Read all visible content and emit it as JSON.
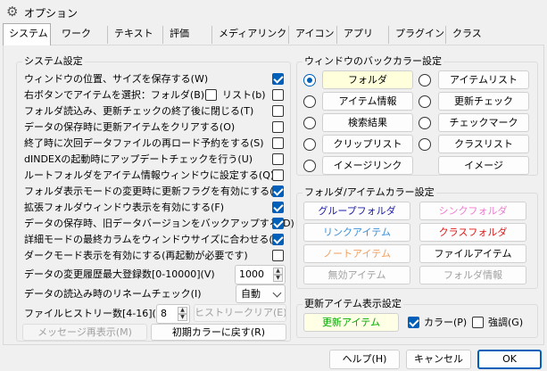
{
  "window": {
    "title": "オプション",
    "icon": "gear-icon"
  },
  "tabs": [
    "システム",
    "ワーク",
    "テキスト",
    "評価",
    "メディアリンク",
    "アイコン",
    "アプリ",
    "プラグイン",
    "クラス"
  ],
  "system": {
    "title": "システム設定",
    "options": [
      {
        "label": "ウィンドウの位置、サイズを保存する(W)",
        "checked": true
      },
      {
        "label": "右ボタンでアイテムを選択：フォルダ(B)",
        "checked": false,
        "extra_label": "リスト(b)",
        "extra_checked": false
      },
      {
        "label": "フォルダ読込み、更新チェックの終了後に閉じる(T)",
        "checked": false
      },
      {
        "label": "データの保存時に更新アイテムをクリアする(O)",
        "checked": false
      },
      {
        "label": "終了時に次回データファイルの再ロード予約をする(S)",
        "checked": false
      },
      {
        "label": "dINDEXの起動時にアップデートチェックを行う(U)",
        "checked": false
      },
      {
        "label": "ルートフォルダをアイテム情報ウィンドウに設定する(Q)",
        "checked": false
      },
      {
        "label": "フォルダ表示モードの変更時に更新フラグを有効にする(Y)",
        "checked": true
      },
      {
        "label": "拡張フォルダウィンドウ表示を有効にする(F)",
        "checked": true
      },
      {
        "label": "データの保存時、旧データバージョンをバックアップする(D)",
        "checked": true
      },
      {
        "label": "詳細モードの最終カラムをウィンドウサイズに合わせる(A)",
        "checked": true
      },
      {
        "label": "ダークモード表示を有効にする(再起動が必要です)",
        "checked": false
      }
    ],
    "history_max_label": "データの変更履歴最大登録数[0-10000](V)",
    "history_max_value": "1000",
    "rename_check_label": "データの読込み時のリネームチェック(I)",
    "rename_check_value": "自動",
    "file_history_label": "ファイルヒストリー数[4-16](N)",
    "file_history_value": "8",
    "clear_history_label": "ヒストリークリア(E)",
    "redisplay_label": "メッセージ再表示(M)",
    "reset_colors_label": "初期カラーに戻す(R)"
  },
  "bgcolor": {
    "title": "ウィンドウのバックカラー設定",
    "left": [
      {
        "label": "フォルダ",
        "selected": true,
        "bg": "#ffffdc"
      },
      {
        "label": "アイテム情報",
        "selected": false,
        "bg": "#fdfdfd"
      },
      {
        "label": "検索結果",
        "selected": false,
        "bg": "#fdfdfd"
      },
      {
        "label": "クリップリスト",
        "selected": false,
        "bg": "#fdfdfd"
      },
      {
        "label": "イメージリンク",
        "selected": false,
        "bg": "#fdfdfd"
      }
    ],
    "right": [
      {
        "label": "アイテムリスト",
        "selected": false,
        "bg": "#fdfdfd"
      },
      {
        "label": "更新チェック",
        "selected": false,
        "bg": "#fdfdfd"
      },
      {
        "label": "チェックマーク",
        "selected": false,
        "bg": "#fdfdfd"
      },
      {
        "label": "クラスリスト",
        "selected": false,
        "bg": "#fdfdfd"
      },
      {
        "label": "イメージ",
        "selected": null,
        "bg": "#fdfdfd"
      }
    ]
  },
  "folder_item_colors": {
    "title": "フォルダ/アイテムカラー設定",
    "buttons": [
      {
        "label": "グループフォルダ",
        "color": "#1a1aa6"
      },
      {
        "label": "シンクフォルダ",
        "color": "#f07ad0"
      },
      {
        "label": "リンクアイテム",
        "color": "#3a8fd8"
      },
      {
        "label": "クラスフォルダ",
        "color": "#e01818"
      },
      {
        "label": "ノートアイテム",
        "color": "#f0a060"
      },
      {
        "label": "ファイルアイテム",
        "color": "#000000"
      },
      {
        "label": "無効アイテム",
        "color": "#a0a0a0"
      },
      {
        "label": "フォルダ情報",
        "color": "#a0a0a0"
      }
    ]
  },
  "update_display": {
    "title": "更新アイテム表示設定",
    "button_label": "更新アイテム",
    "button_color": "#00aa00",
    "color_label": "カラー(P)",
    "color_checked": true,
    "bold_label": "強調(G)",
    "bold_checked": false
  },
  "footer": {
    "help_label": "ヘルプ(H)",
    "cancel_label": "キャンセル",
    "ok_label": "OK"
  }
}
